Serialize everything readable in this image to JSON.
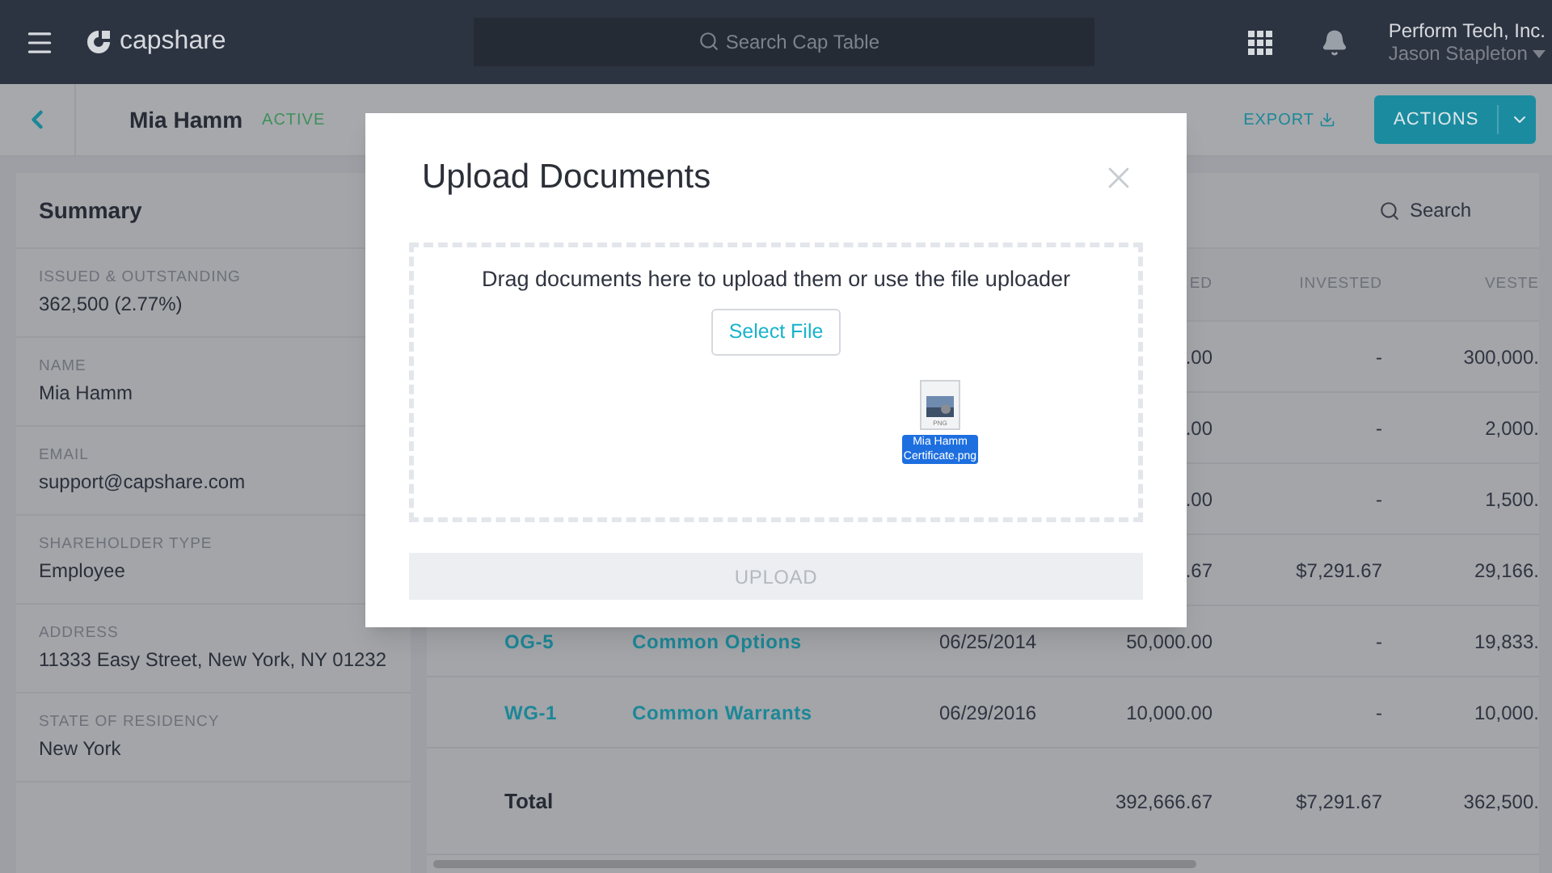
{
  "top_bar": {
    "brand": "capshare",
    "search": {
      "placeholder": "Search Cap Table"
    },
    "org": "Perform Tech, Inc.",
    "user": "Jason Stapleton"
  },
  "subheader": {
    "name": "Mia Hamm",
    "status": "ACTIVE",
    "export": "EXPORT",
    "actions": "ACTIONS"
  },
  "summary": {
    "title": "Summary",
    "fields": [
      {
        "label": "ISSUED & OUTSTANDING",
        "value": "362,500 (2.77%)"
      },
      {
        "label": "NAME",
        "value": "Mia Hamm"
      },
      {
        "label": "EMAIL",
        "value": "support@capshare.com"
      },
      {
        "label": "SHAREHOLDER TYPE",
        "value": "Employee"
      },
      {
        "label": "ADDRESS",
        "value": "11333 Easy Street, New York, NY 01232"
      },
      {
        "label": "STATE OF RESIDENCY",
        "value": "New York"
      }
    ]
  },
  "table": {
    "search": "Search",
    "columns": [
      "ED",
      "INVESTED",
      "VESTE"
    ],
    "rows": [
      {
        "issued": ".00",
        "invested": "-",
        "vested": "300,000."
      },
      {
        "issued": ".00",
        "invested": "-",
        "vested": "2,000."
      },
      {
        "issued": ".00",
        "invested": "-",
        "vested": "1,500."
      },
      {
        "issued": ".67",
        "invested": "$7,291.67",
        "vested": "29,166."
      },
      {
        "id": "OG-5",
        "name": "Common Options",
        "date": "06/25/2014",
        "issued": "50,000.00",
        "invested": "-",
        "vested": "19,833."
      },
      {
        "id": "WG-1",
        "name": "Common Warrants",
        "date": "06/29/2016",
        "issued": "10,000.00",
        "invested": "-",
        "vested": "10,000."
      }
    ],
    "total": {
      "label": "Total",
      "issued": "392,666.67",
      "invested": "$7,291.67",
      "vested": "362,500."
    }
  },
  "modal": {
    "title": "Upload Documents",
    "hint": "Drag documents here to upload them or use the file uploader",
    "select": "Select File",
    "file": {
      "type": "PNG",
      "name": "Mia Hamm Certificate.png"
    },
    "upload": {
      "label": "UPLOAD",
      "disabled": true
    }
  }
}
